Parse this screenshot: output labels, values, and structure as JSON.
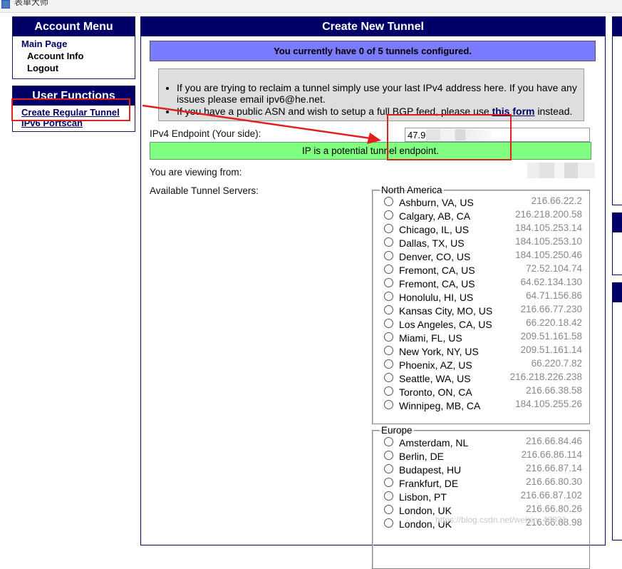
{
  "window": {
    "title": "表单大师"
  },
  "account_menu": {
    "header": "Account Menu",
    "main_page": "Main Page",
    "account_info": "Account Info",
    "logout": "Logout"
  },
  "user_functions": {
    "header": "User Functions",
    "create_regular_tunnel": "Create Regular Tunnel",
    "ipv6_portscan": "IPv6 Portscan"
  },
  "main": {
    "header": "Create New Tunnel",
    "banner": "You currently have 0 of 5 tunnels configured.",
    "info_1": "If you are trying to reclaim a tunnel simply use your last IPv4 address here. If you have any issues please email ipv6@he.net.",
    "info_2_pre": "If you have a public ASN and wish to setup a full BGP feed, please use ",
    "info_2_link": "this form",
    "info_2_post": " instead.",
    "endpoint_label": "IPv4 Endpoint (Your side):",
    "endpoint_value": "47.9",
    "endpoint_status": "IP is a potential tunnel endpoint.",
    "viewing_label": "You are viewing from:",
    "servers_label": "Available Tunnel Servers:"
  },
  "regions": {
    "north_america": {
      "legend": "North America",
      "servers": [
        {
          "city": "Ashburn, VA, US",
          "ip": "216.66.22.2"
        },
        {
          "city": "Calgary, AB, CA",
          "ip": "216.218.200.58"
        },
        {
          "city": "Chicago, IL, US",
          "ip": "184.105.253.14"
        },
        {
          "city": "Dallas, TX, US",
          "ip": "184.105.253.10"
        },
        {
          "city": "Denver, CO, US",
          "ip": "184.105.250.46"
        },
        {
          "city": "Fremont, CA, US",
          "ip": "72.52.104.74"
        },
        {
          "city": "Fremont, CA, US",
          "ip": "64.62.134.130"
        },
        {
          "city": "Honolulu, HI, US",
          "ip": "64.71.156.86"
        },
        {
          "city": "Kansas City, MO, US",
          "ip": "216.66.77.230"
        },
        {
          "city": "Los Angeles, CA, US",
          "ip": "66.220.18.42"
        },
        {
          "city": "Miami, FL, US",
          "ip": "209.51.161.58"
        },
        {
          "city": "New York, NY, US",
          "ip": "209.51.161.14"
        },
        {
          "city": "Phoenix, AZ, US",
          "ip": "66.220.7.82"
        },
        {
          "city": "Seattle, WA, US",
          "ip": "216.218.226.238"
        },
        {
          "city": "Toronto, ON, CA",
          "ip": "216.66.38.58"
        },
        {
          "city": "Winnipeg, MB, CA",
          "ip": "184.105.255.26"
        }
      ]
    },
    "europe": {
      "legend": "Europe",
      "servers": [
        {
          "city": "Amsterdam, NL",
          "ip": "216.66.84.46"
        },
        {
          "city": "Berlin, DE",
          "ip": "216.66.86.114"
        },
        {
          "city": "Budapest, HU",
          "ip": "216.66.87.14"
        },
        {
          "city": "Frankfurt, DE",
          "ip": "216.66.80.30"
        },
        {
          "city": "Lisbon, PT",
          "ip": "216.66.87.102"
        },
        {
          "city": "London, UK",
          "ip": "216.66.80.26"
        },
        {
          "city": "London, UK",
          "ip": "216.66.88.98"
        }
      ]
    }
  },
  "watermark": "https://blog.csdn.net/weixin_48931",
  "colors": {
    "header_navy": "#000066",
    "banner_purple": "#7b7bff",
    "status_green": "#80ff80",
    "annotation_red": "#e02020"
  }
}
